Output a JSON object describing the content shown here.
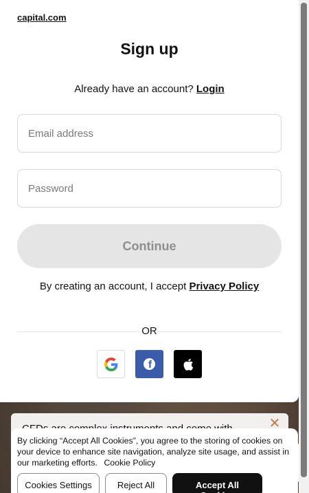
{
  "brand": {
    "logo_text": "capital.com"
  },
  "signup": {
    "title": "Sign up",
    "have_account_text": "Already have an account?",
    "login_link": "Login",
    "email_placeholder": "Email address",
    "password_placeholder": "Password",
    "continue_label": "Continue",
    "policy_text": "By creating an account, I accept",
    "privacy_link": "Privacy Policy",
    "or_label": "OR",
    "social": [
      {
        "name": "google-icon",
        "label": "Google"
      },
      {
        "name": "facebook-icon",
        "label": "Facebook"
      },
      {
        "name": "apple-icon",
        "label": "Apple"
      }
    ]
  },
  "cfd_banner": {
    "text": "CFDs are complex instruments and come with"
  },
  "cookie": {
    "text": "By clicking “Accept All Cookies”, you agree to the storing of cookies on your device to enhance site navigation, analyze site usage, and assist in our marketing efforts.",
    "policy_link": "Cookie Policy",
    "settings_label": "Cookies Settings",
    "reject_label": "Reject All",
    "accept_label": "Accept All Cookies"
  },
  "colors": {
    "accent_close": "#c97a4a",
    "facebook": "#3b5bab",
    "continue_disabled_bg": "#e5e5e5"
  }
}
